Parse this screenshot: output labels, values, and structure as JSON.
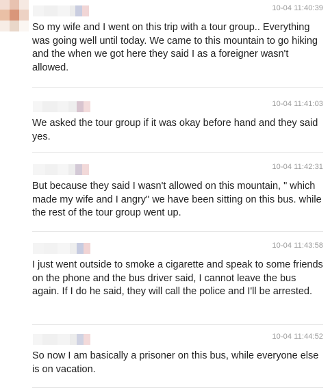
{
  "messages": [
    {
      "timestamp": "10-04 11:40:39",
      "text": "So my wife and I went on this trip with a tour group.. Everything was going well until today. We came to this mountain to go hiking and the when we got here they said I as a foreigner wasn't allowed."
    },
    {
      "timestamp": "10-04 11:41:03",
      "text": "We asked the tour group if it was okay before hand and they said yes."
    },
    {
      "timestamp": "10-04 11:42:31",
      "text": "But because they said I wasn't allowed on this mountain, \" which made my wife and I angry\" we have been sitting on this bus. while the rest of the tour group went up."
    },
    {
      "timestamp": "10-04 11:43:58",
      "text": "I just went outside to smoke a cigarette and speak to some friends on the phone and the bus driver said, I cannot leave the bus again. If I do he said, they will call the police and I'll be arrested."
    },
    {
      "timestamp": "10-04 11:44:52",
      "text": "So now I am basically a prisoner on this bus, while everyone else is on vacation."
    }
  ],
  "colors": {
    "timestamp": "#9a9a9a",
    "text": "#222222",
    "divider": "#e6e6e6"
  }
}
